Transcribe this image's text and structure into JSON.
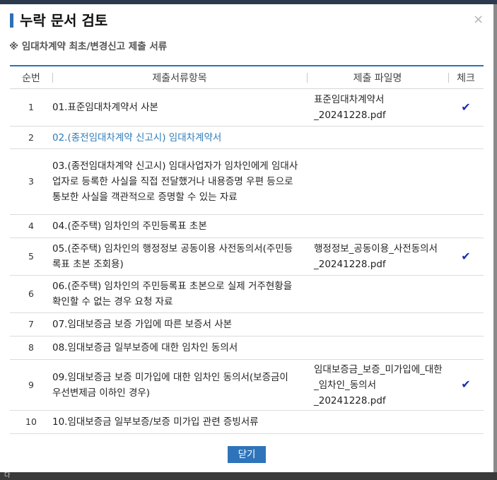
{
  "dialog": {
    "title": "누락 문서 검토",
    "close_symbol": "×",
    "subtitle": "※ 임대차계약 최초/변경신고 제출 서류",
    "close_button": "닫기"
  },
  "background": {
    "partial_text": "다"
  },
  "table": {
    "headers": [
      "순번",
      "제출서류항목",
      "제출 파일명",
      "체크"
    ],
    "rows": [
      {
        "no": "1",
        "item": "01.표준임대차계약서 사본",
        "file": "표준임대차계약서_20241228.pdf",
        "checked": true,
        "link": false
      },
      {
        "no": "2",
        "item": "02.(종전임대차계약 신고시) 임대차계약서",
        "file": "",
        "checked": false,
        "link": true
      },
      {
        "no": "3",
        "item": "03.(종전임대차계약 신고시) 임대사업자가 임차인에게 임대사업자로 등록한 사실을 직접 전달했거나 내용증명 우편 등으로 통보한 사실을 객관적으로 증명할 수 있는 자료",
        "file": "",
        "checked": false,
        "link": false
      },
      {
        "no": "4",
        "item": "04.(준주택) 임차인의 주민등록표 초본",
        "file": "",
        "checked": false,
        "link": false
      },
      {
        "no": "5",
        "item": "05.(준주택) 임차인의 행정정보 공동이용 사전동의서(주민등록표 초본 조회용)",
        "file": "행정정보_공동이용_사전동의서_20241228.pdf",
        "checked": true,
        "link": false
      },
      {
        "no": "6",
        "item": "06.(준주택) 임차인의 주민등록표 초본으로 실제 거주현황을 확인할 수 없는 경우 요청 자료",
        "file": "",
        "checked": false,
        "link": false
      },
      {
        "no": "7",
        "item": "07.임대보증금 보증 가입에 따른 보증서 사본",
        "file": "",
        "checked": false,
        "link": false
      },
      {
        "no": "8",
        "item": "08.임대보증금 일부보증에 대한 임차인 동의서",
        "file": "",
        "checked": false,
        "link": false
      },
      {
        "no": "9",
        "item": "09.임대보증금 보증 미가입에 대한 임차인 동의서(보증금이 우선변제금 이하인 경우)",
        "file": "임대보증금_보증_미가입에_대한_임차인_동의서_20241228.pdf",
        "checked": true,
        "link": false
      },
      {
        "no": "10",
        "item": "10.임대보증금 일부보증/보증 미가입 관련 증빙서류",
        "file": "",
        "checked": false,
        "link": false
      }
    ]
  },
  "icons": {
    "check": "check-icon",
    "check_color": "#1a2fb8",
    "accent": "#2f74bb"
  }
}
